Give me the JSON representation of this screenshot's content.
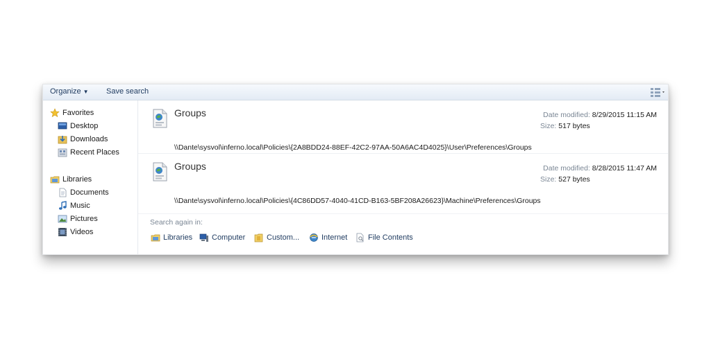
{
  "toolbar": {
    "organize_label": "Organize",
    "save_search_label": "Save search"
  },
  "nav": {
    "favorites": {
      "label": "Favorites",
      "items": [
        {
          "label": "Desktop",
          "icon": "desktop-icon"
        },
        {
          "label": "Downloads",
          "icon": "downloads-icon"
        },
        {
          "label": "Recent Places",
          "icon": "recent-places-icon"
        }
      ]
    },
    "libraries": {
      "label": "Libraries",
      "items": [
        {
          "label": "Documents",
          "icon": "documents-icon"
        },
        {
          "label": "Music",
          "icon": "music-icon"
        },
        {
          "label": "Pictures",
          "icon": "pictures-icon"
        },
        {
          "label": "Videos",
          "icon": "videos-icon"
        }
      ]
    }
  },
  "results": [
    {
      "title": "Groups",
      "date_label": "Date modified:",
      "date_value": "8/29/2015 11:15 AM",
      "size_label": "Size:",
      "size_value": "517 bytes",
      "path": "\\\\Dante\\sysvol\\inferno.local\\Policies\\{2A8BDD24-88EF-42C2-97AA-50A6AC4D4025}\\User\\Preferences\\Groups"
    },
    {
      "title": "Groups",
      "date_label": "Date modified:",
      "date_value": "8/28/2015 11:47 AM",
      "size_label": "Size:",
      "size_value": "527 bytes",
      "path": "\\\\Dante\\sysvol\\inferno.local\\Policies\\{4C86DD57-4040-41CD-B163-5BF208A26623}\\Machine\\Preferences\\Groups"
    }
  ],
  "search_again": {
    "label": "Search again in:",
    "locations": [
      {
        "label": "Libraries",
        "icon": "libraries-icon"
      },
      {
        "label": "Computer",
        "icon": "computer-icon"
      },
      {
        "label": "Custom...",
        "icon": "custom-folder-icon"
      },
      {
        "label": "Internet",
        "icon": "internet-icon"
      },
      {
        "label": "File Contents",
        "icon": "file-contents-icon"
      }
    ]
  },
  "colors": {
    "toolbar_text": "#1e3a5f",
    "meta_label": "#7a8694",
    "accent_blue": "#2f6fb7"
  }
}
